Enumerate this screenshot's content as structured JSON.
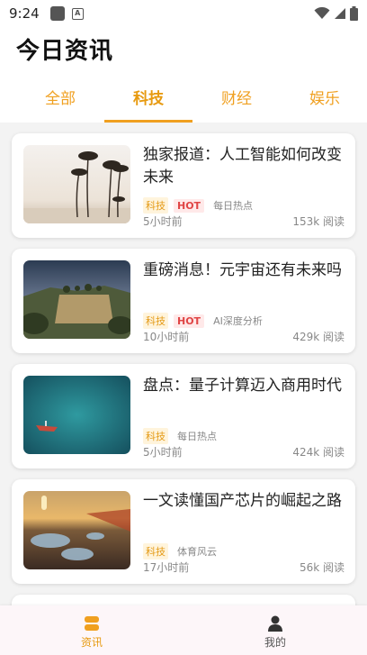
{
  "status_bar": {
    "time": "9:24",
    "icons": [
      "notification-square-icon",
      "a-badge-icon",
      "wifi-icon",
      "signal-icon",
      "battery-icon"
    ]
  },
  "header": {
    "title": "今日资讯"
  },
  "tabs": [
    {
      "label": "全部",
      "active": false
    },
    {
      "label": "科技",
      "active": true
    },
    {
      "label": "财经",
      "active": false
    },
    {
      "label": "娱乐",
      "active": false
    }
  ],
  "articles": [
    {
      "title": "独家报道：人工智能如何改变未来",
      "category": "科技",
      "hot": "HOT",
      "source": "每日热点",
      "time": "5小时前",
      "reads": "153k 阅读",
      "image": "palm-trees-beach"
    },
    {
      "title": "重磅消息！元宇宙还有未来吗",
      "category": "科技",
      "hot": "HOT",
      "source": "AI深度分析",
      "time": "10小时前",
      "reads": "429k 阅读",
      "image": "hillside-village"
    },
    {
      "title": "盘点：量子计算迈入商用时代",
      "category": "科技",
      "hot": null,
      "source": "每日热点",
      "time": "5小时前",
      "reads": "424k 阅读",
      "image": "boat-on-lake"
    },
    {
      "title": "一文读懂国产芯片的崛起之路",
      "category": "科技",
      "hot": null,
      "source": "体育风云",
      "time": "17小时前",
      "reads": "56k 阅读",
      "image": "sunset-road-puddles"
    }
  ],
  "bottom_nav": [
    {
      "label": "资讯",
      "icon": "news-icon",
      "active": true
    },
    {
      "label": "我的",
      "icon": "profile-icon",
      "active": false
    }
  ],
  "colors": {
    "accent": "#f0a020",
    "hot_text": "#e04545",
    "hot_bg": "#ffe9e9",
    "category_bg": "#fff4dc"
  }
}
